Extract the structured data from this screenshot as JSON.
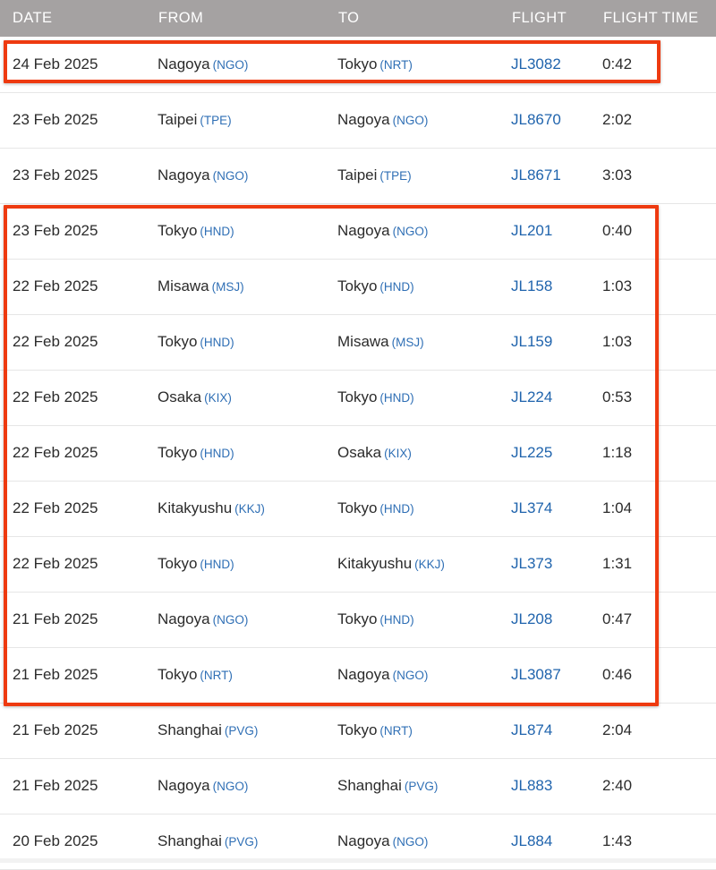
{
  "table": {
    "columns": [
      {
        "key": "date",
        "label": "DATE"
      },
      {
        "key": "from",
        "label": "FROM"
      },
      {
        "key": "to",
        "label": "TO"
      },
      {
        "key": "flight",
        "label": "FLIGHT"
      },
      {
        "key": "time",
        "label": "FLIGHT TIME"
      }
    ],
    "rows": [
      {
        "date": "24 Feb 2025",
        "from_city": "Nagoya",
        "from_code": "(NGO)",
        "to_city": "Tokyo",
        "to_code": "(NRT)",
        "flight": "JL3082",
        "time": "0:42"
      },
      {
        "date": "23 Feb 2025",
        "from_city": "Taipei",
        "from_code": "(TPE)",
        "to_city": "Nagoya",
        "to_code": "(NGO)",
        "flight": "JL8670",
        "time": "2:02"
      },
      {
        "date": "23 Feb 2025",
        "from_city": "Nagoya",
        "from_code": "(NGO)",
        "to_city": "Taipei",
        "to_code": "(TPE)",
        "flight": "JL8671",
        "time": "3:03"
      },
      {
        "date": "23 Feb 2025",
        "from_city": "Tokyo",
        "from_code": "(HND)",
        "to_city": "Nagoya",
        "to_code": "(NGO)",
        "flight": "JL201",
        "time": "0:40"
      },
      {
        "date": "22 Feb 2025",
        "from_city": "Misawa",
        "from_code": "(MSJ)",
        "to_city": "Tokyo",
        "to_code": "(HND)",
        "flight": "JL158",
        "time": "1:03"
      },
      {
        "date": "22 Feb 2025",
        "from_city": "Tokyo",
        "from_code": "(HND)",
        "to_city": "Misawa",
        "to_code": "(MSJ)",
        "flight": "JL159",
        "time": "1:03"
      },
      {
        "date": "22 Feb 2025",
        "from_city": "Osaka",
        "from_code": "(KIX)",
        "to_city": "Tokyo",
        "to_code": "(HND)",
        "flight": "JL224",
        "time": "0:53"
      },
      {
        "date": "22 Feb 2025",
        "from_city": "Tokyo",
        "from_code": "(HND)",
        "to_city": "Osaka",
        "to_code": "(KIX)",
        "flight": "JL225",
        "time": "1:18"
      },
      {
        "date": "22 Feb 2025",
        "from_city": "Kitakyushu",
        "from_code": "(KKJ)",
        "to_city": "Tokyo",
        "to_code": "(HND)",
        "flight": "JL374",
        "time": "1:04"
      },
      {
        "date": "22 Feb 2025",
        "from_city": "Tokyo",
        "from_code": "(HND)",
        "to_city": "Kitakyushu",
        "to_code": "(KKJ)",
        "flight": "JL373",
        "time": "1:31"
      },
      {
        "date": "21 Feb 2025",
        "from_city": "Nagoya",
        "from_code": "(NGO)",
        "to_city": "Tokyo",
        "to_code": "(HND)",
        "flight": "JL208",
        "time": "0:47"
      },
      {
        "date": "21 Feb 2025",
        "from_city": "Tokyo",
        "from_code": "(NRT)",
        "to_city": "Nagoya",
        "to_code": "(NGO)",
        "flight": "JL3087",
        "time": "0:46"
      },
      {
        "date": "21 Feb 2025",
        "from_city": "Shanghai",
        "from_code": "(PVG)",
        "to_city": "Tokyo",
        "to_code": "(NRT)",
        "flight": "JL874",
        "time": "2:04"
      },
      {
        "date": "21 Feb 2025",
        "from_city": "Nagoya",
        "from_code": "(NGO)",
        "to_city": "Shanghai",
        "to_code": "(PVG)",
        "flight": "JL883",
        "time": "2:40"
      },
      {
        "date": "20 Feb 2025",
        "from_city": "Shanghai",
        "from_code": "(PVG)",
        "to_city": "Nagoya",
        "to_code": "(NGO)",
        "flight": "JL884",
        "time": "1:43"
      }
    ]
  },
  "annotations": {
    "color": "#ee3a10",
    "boxes": [
      {
        "id": "hl-1",
        "covers_rows": [
          0
        ]
      },
      {
        "id": "hl-2",
        "covers_rows": [
          3,
          4,
          5,
          6,
          7,
          8,
          9,
          10,
          11
        ]
      }
    ]
  },
  "colors": {
    "header_background": "#a5a2a2",
    "header_text": "#ffffff",
    "row_background": "#ffffff",
    "row_divider": "#e6e6e6",
    "body_text": "#2b2b2b",
    "airport_code": "#2f6fb5",
    "flight_link": "#2064ad",
    "highlight": "#ee3a10"
  }
}
